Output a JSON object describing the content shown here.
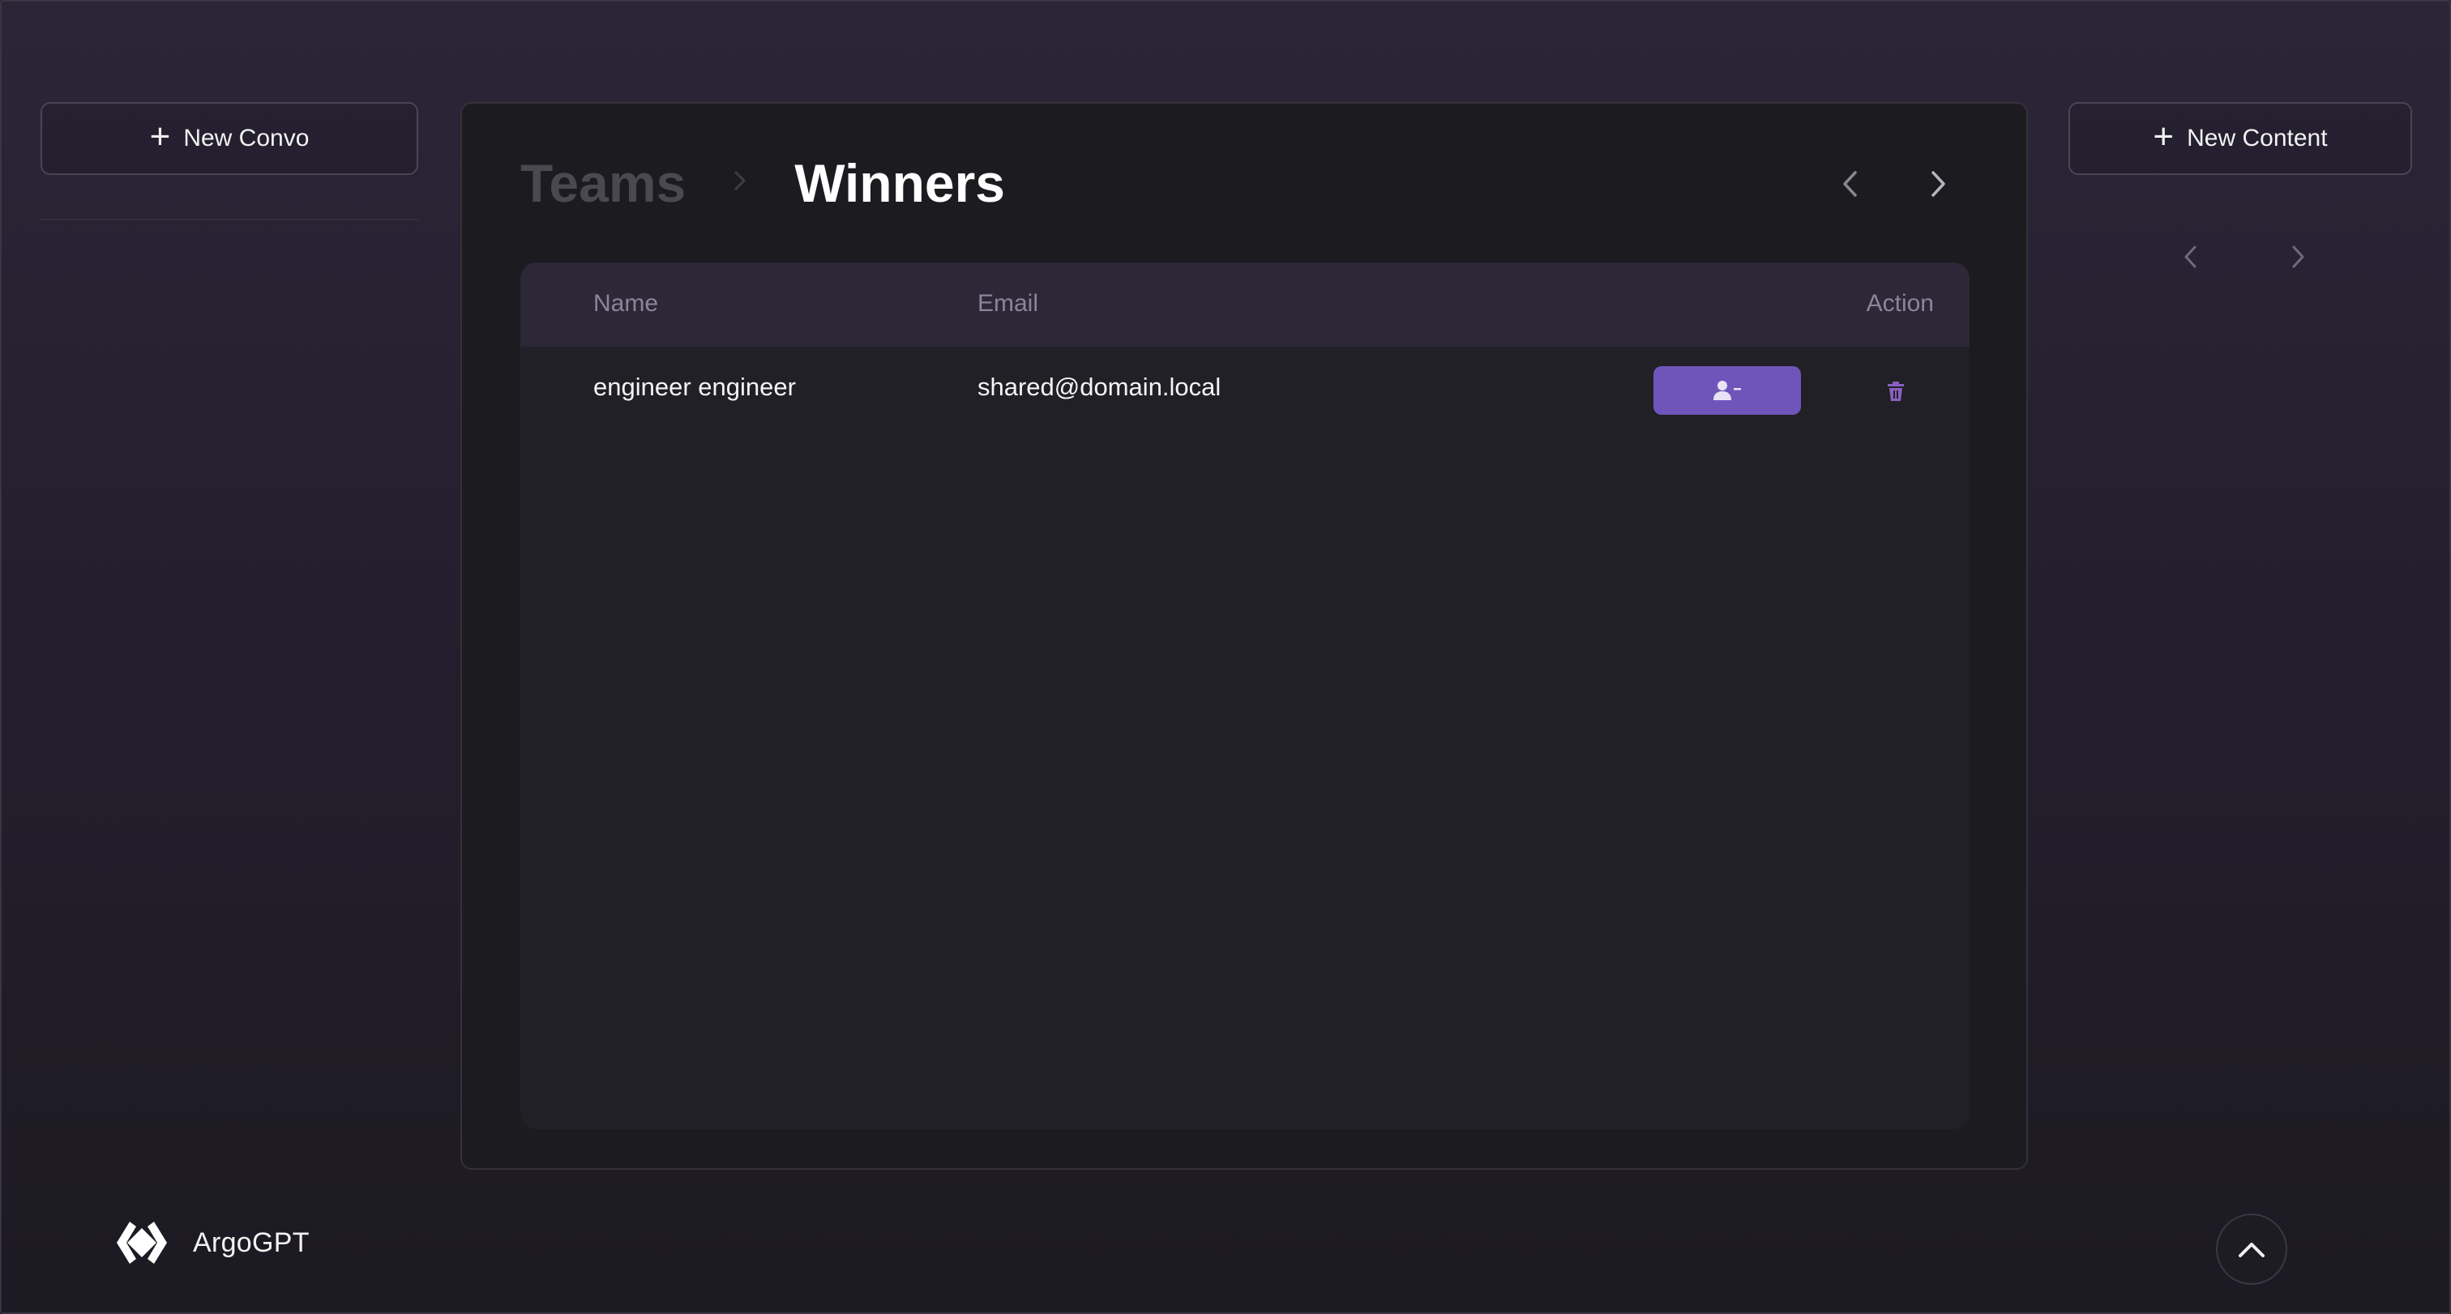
{
  "sidebar": {
    "new_convo_label": "New Convo",
    "brand_name": "ArgoGPT"
  },
  "breadcrumb": {
    "parent": "Teams",
    "current": "Winners"
  },
  "table": {
    "columns": [
      "Name",
      "Email",
      "Action"
    ],
    "rows": [
      {
        "name": "engineer engineer",
        "email": "shared@domain.local"
      }
    ]
  },
  "right_panel": {
    "new_content_label": "New Content"
  },
  "icons": {
    "plus": "plus-icon",
    "chevron_left": "chevron-left-icon",
    "chevron_right": "chevron-right-icon",
    "user_minus": "user-minus-icon",
    "trash": "trash-icon",
    "chevron_up": "chevron-up-icon",
    "logo": "argogpt-logo"
  },
  "colors": {
    "accent": "#6f55ba",
    "panel_bg": "#1c1b1f",
    "table_header_bg": "#2c2837",
    "trash_icon": "#8a5fc2"
  }
}
